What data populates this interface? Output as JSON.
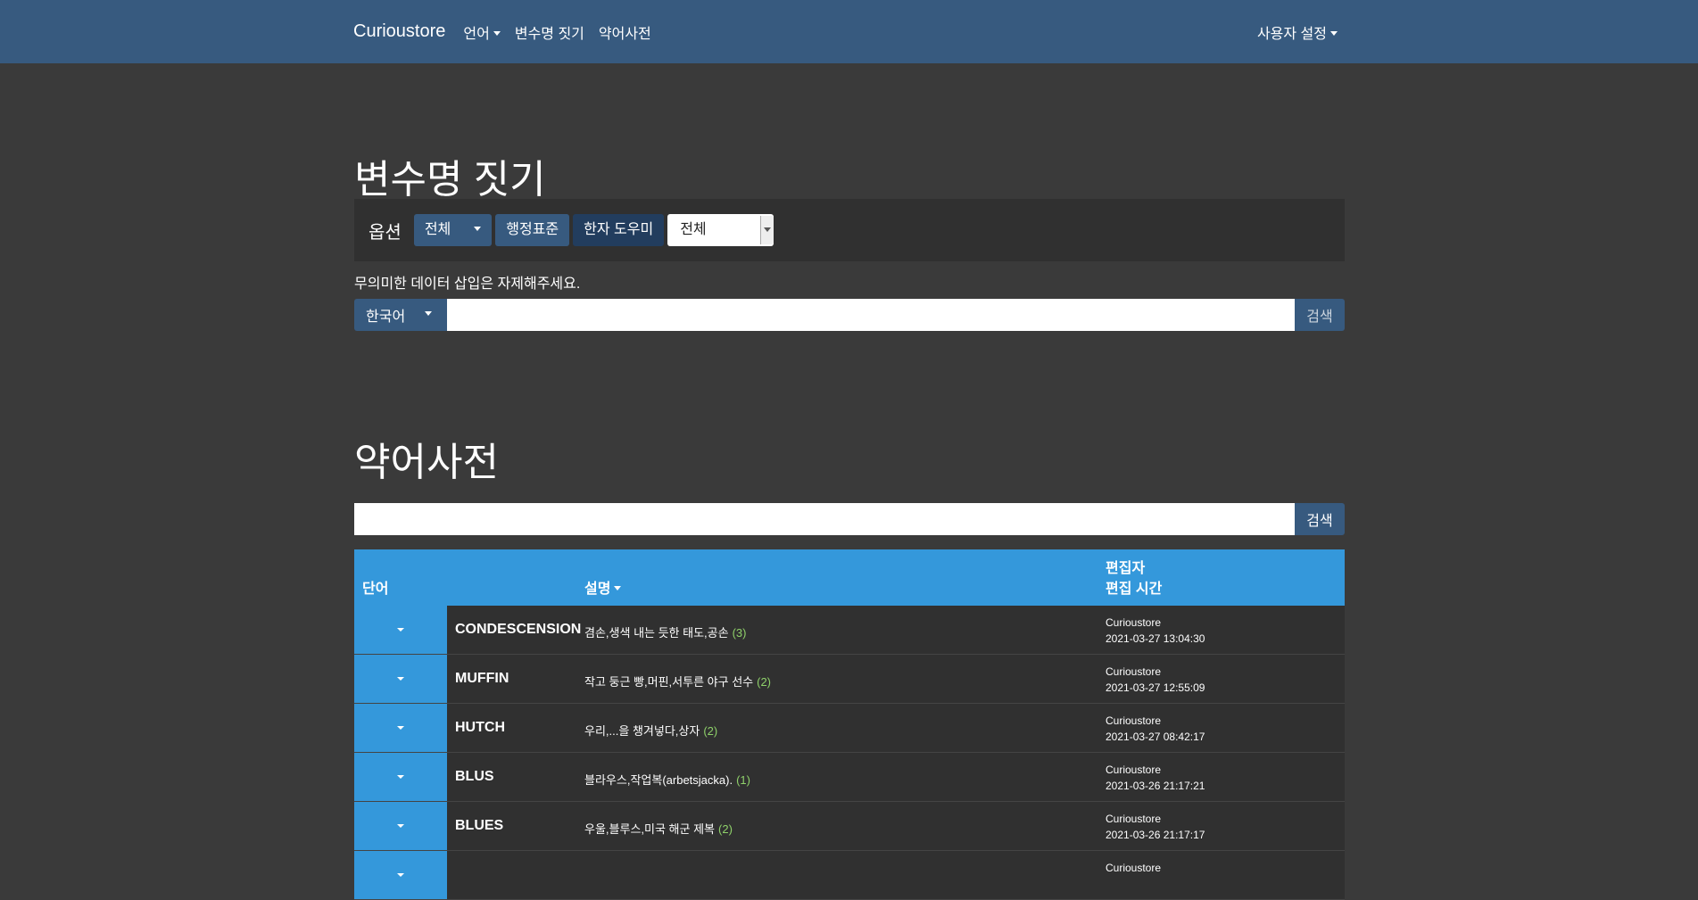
{
  "navbar": {
    "brand": "Curioustore",
    "items": [
      "언어",
      "변수명 짓기",
      "약어사전"
    ],
    "user_menu": "사용자 설정"
  },
  "naming": {
    "title": "변수명 짓기",
    "options_label": "옵션",
    "scope_button": "전체",
    "admin_standard_button": "행정표준",
    "hanja_helper_button": "한자 도우미",
    "select_value": "전체",
    "notice": "무의미한 데이터 삽입은 자제해주세요.",
    "language_button": "한국어",
    "search_input_value": "",
    "search_button": "검색"
  },
  "dictionary": {
    "title": "약어사전",
    "search_input_value": "",
    "search_button": "검색",
    "headers": {
      "word": "단어",
      "description": "설명",
      "editor": "편집자",
      "edited_time": "편집 시간"
    },
    "rows": [
      {
        "word": "CONDESCENSION",
        "description": "겸손,생색 내는 듯한 태도,공손",
        "count": "(3)",
        "editor": "Curioustore",
        "time": "2021-03-27 13:04:30"
      },
      {
        "word": "MUFFIN",
        "description": "작고 둥근 빵,머핀,서투른 야구 선수",
        "count": "(2)",
        "editor": "Curioustore",
        "time": "2021-03-27 12:55:09"
      },
      {
        "word": "HUTCH",
        "description": "우리,...을 챙겨넣다,상자",
        "count": "(2)",
        "editor": "Curioustore",
        "time": "2021-03-27 08:42:17"
      },
      {
        "word": "BLUS",
        "description": "블라우스,작업복(arbetsjacka).",
        "count": "(1)",
        "editor": "Curioustore",
        "time": "2021-03-26 21:17:21"
      },
      {
        "word": "BLUES",
        "description": "우울,블루스,미국 해군 제복",
        "count": "(2)",
        "editor": "Curioustore",
        "time": "2021-03-26 21:17:17"
      },
      {
        "word": "",
        "description": "",
        "count": "",
        "editor": "Curioustore",
        "time": ""
      }
    ]
  }
}
